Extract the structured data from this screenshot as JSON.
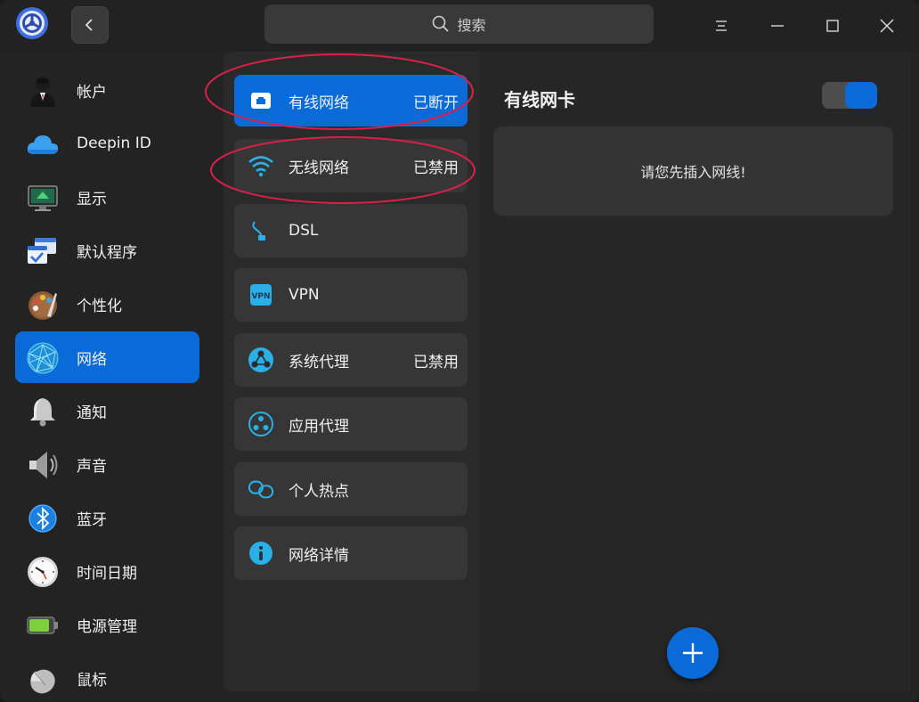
{
  "titlebar": {
    "search_placeholder": "搜索"
  },
  "sidebar": {
    "items": [
      {
        "label": "帐户",
        "icon": "account-icon"
      },
      {
        "label": "Deepin ID",
        "icon": "cloud-icon"
      },
      {
        "label": "显示",
        "icon": "display-icon"
      },
      {
        "label": "默认程序",
        "icon": "default-apps-icon"
      },
      {
        "label": "个性化",
        "icon": "palette-icon"
      },
      {
        "label": "网络",
        "icon": "network-globe-icon",
        "active": true
      },
      {
        "label": "通知",
        "icon": "bell-icon"
      },
      {
        "label": "声音",
        "icon": "speaker-icon"
      },
      {
        "label": "蓝牙",
        "icon": "bluetooth-icon"
      },
      {
        "label": "时间日期",
        "icon": "clock-icon"
      },
      {
        "label": "电源管理",
        "icon": "battery-icon"
      },
      {
        "label": "鼠标",
        "icon": "mouse-icon"
      }
    ]
  },
  "middle": {
    "items": [
      {
        "label": "有线网络",
        "status": "已断开",
        "icon": "wired-network-icon",
        "active": true
      },
      {
        "label": "无线网络",
        "status": "已禁用",
        "icon": "wifi-icon"
      },
      {
        "label": "DSL",
        "status": "",
        "icon": "dsl-icon"
      },
      {
        "label": "VPN",
        "status": "",
        "icon": "vpn-icon"
      },
      {
        "label": "系统代理",
        "status": "已禁用",
        "icon": "system-proxy-icon"
      },
      {
        "label": "应用代理",
        "status": "",
        "icon": "app-proxy-icon"
      },
      {
        "label": "个人热点",
        "status": "",
        "icon": "hotspot-icon"
      },
      {
        "label": "网络详情",
        "status": "",
        "icon": "info-icon"
      }
    ]
  },
  "right": {
    "title": "有线网卡",
    "toggle_on": true,
    "message": "请您先插入网线!"
  },
  "colors": {
    "accent": "#0a6bd8",
    "annotation": "#d8204a"
  }
}
